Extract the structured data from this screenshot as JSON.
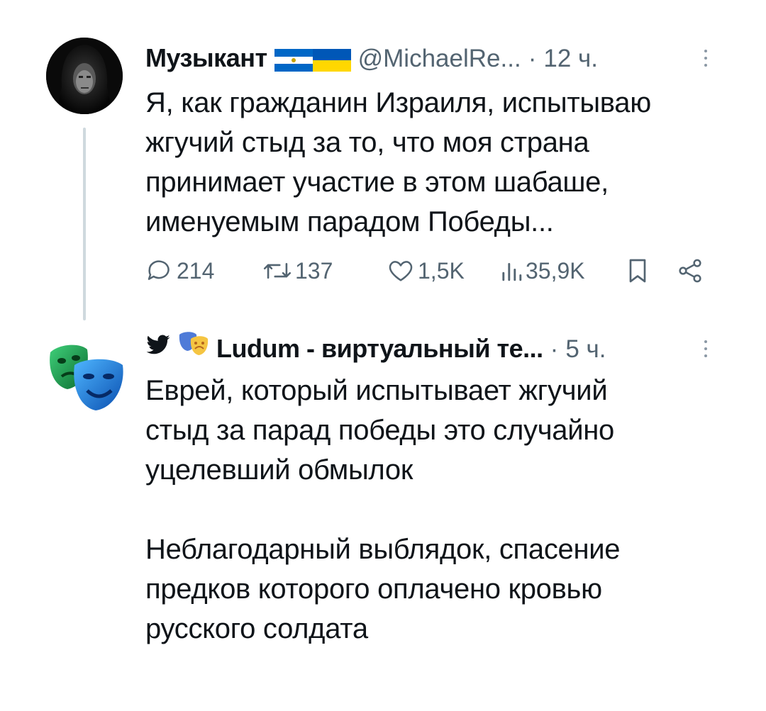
{
  "tweets": [
    {
      "author_name": "Музыкант",
      "handle": "@MichaelRe...",
      "separator": "·",
      "time": "12 ч.",
      "flags": [
        "nicaragua-flag",
        "ukraine-flag"
      ],
      "text_lines": [
        "Я, как гражданин Израиля, испытываю",
        "жгучий стыд за то, что моя страна",
        "принимает участие в этом шабаше,",
        "именуемым парадом Победы..."
      ],
      "actions": {
        "replies": "214",
        "reposts": "137",
        "likes": "1,5K",
        "views": "35,9K"
      }
    },
    {
      "author_name": "Ludum - виртуальный те...",
      "separator": "·",
      "time": "5 ч.",
      "name_prefix_icons": [
        "twitter-bird-icon",
        "theater-masks-icon"
      ],
      "paragraph1": [
        "Еврей, который испытывает жгучий",
        "стыд за парад победы это случайно",
        "уцелевший обмылок"
      ],
      "paragraph2": [
        "Неблагодарный выблядок, спасение",
        "предков которого оплачено кровью",
        "русского солдата"
      ]
    }
  ],
  "colors": {
    "text": "#0f1419",
    "muted": "#536471",
    "thread_line": "#cfd9de",
    "twitter_blue": "#1d9bf0"
  }
}
